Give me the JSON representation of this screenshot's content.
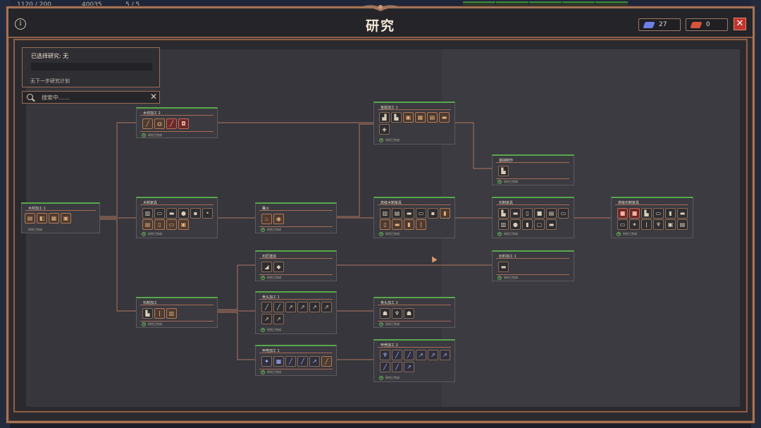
{
  "top_strip": {
    "population": "1120 / 200",
    "gold": "40035",
    "ratio": "5 / 5"
  },
  "window": {
    "title": "研究",
    "info_icon": "info-icon",
    "close_icon": "close-icon"
  },
  "resources": [
    {
      "name": "blue-gem-icon",
      "value": "27",
      "color": "#6f7fe8"
    },
    {
      "name": "red-gem-icon",
      "value": "0",
      "color": "#d9533a"
    }
  ],
  "selected_panel": {
    "label": "已选择研究: 无",
    "next_plan": "无下一步研究计划"
  },
  "search": {
    "placeholder": "搜索中……"
  },
  "colors": {
    "accent_border": "#a0745a",
    "node_header": "#57a84a",
    "connector": "#9a6a5a",
    "close": "#c0342b"
  },
  "nodes": {
    "wood1": {
      "title": "木材加工 1",
      "status": "研究已完成"
    },
    "wood2": {
      "title": "木材加工 2",
      "status": "研究已完成"
    },
    "woodfurn": {
      "title": "木制家具",
      "status": "研究已完成"
    },
    "fire": {
      "title": "篝火",
      "status": "研究已完成"
    },
    "metal1": {
      "title": "金属加工 1",
      "status": "研究已完成"
    },
    "basicprod": {
      "title": "基础制作",
      "status": "研究已完成"
    },
    "advwood": {
      "title": "高级木制家具",
      "status": "研究已完成"
    },
    "stone": {
      "title": "石制家具",
      "status": "研究已完成"
    },
    "advstone": {
      "title": "高级石制家具",
      "status": "研究已完成"
    },
    "stonemason": {
      "title": "石匠建造",
      "status": "研究已完成"
    },
    "stonewk": {
      "title": "石料加工 1",
      "status": "研究已完成"
    },
    "stoneproc": {
      "title": "石制加工",
      "status": "研究已完成"
    },
    "bone1": {
      "title": "骨头加工 1",
      "status": "研究已完成"
    },
    "bone2": {
      "title": "骨头加工 2",
      "status": "研究已完成"
    },
    "armor1": {
      "title": "甲壳加工 1",
      "status": "研究已完成"
    },
    "armor2": {
      "title": "甲壳加工 2",
      "status": "研究已完成"
    }
  }
}
